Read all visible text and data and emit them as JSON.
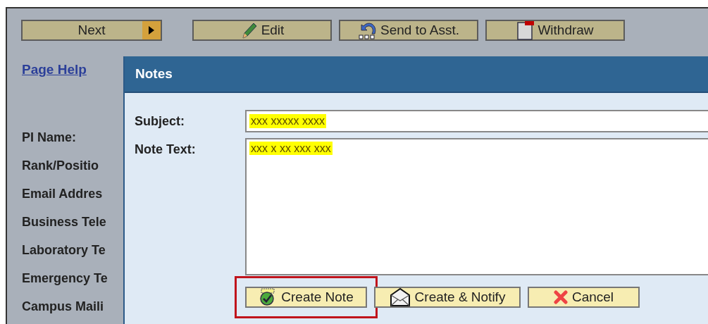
{
  "toolbar": [
    {
      "label": "Next",
      "kind": "next"
    },
    {
      "label": "Edit",
      "kind": "edit"
    },
    {
      "label": "Send to Asst.",
      "kind": "send"
    },
    {
      "label": "Withdraw",
      "kind": "withdraw"
    }
  ],
  "page_help": "Page Help",
  "form_labels": [
    "PI Name:",
    "Rank/Positio",
    "Email Addres",
    "Business Tele",
    "Laboratory Te",
    "Emergency Te",
    "Campus Maili"
  ],
  "dialog": {
    "title": "Notes",
    "subject": {
      "label": "Subject:",
      "value": "xxx xxxxx xxxx",
      "highlighted": true
    },
    "note_text": {
      "label": "Note Text:",
      "value": "xxx x xx xxx xxx",
      "highlighted": true
    },
    "buttons": [
      {
        "label": "Create Note",
        "kind": "create",
        "highlighted": true
      },
      {
        "label": "Create & Notify",
        "kind": "notify",
        "highlighted": false
      },
      {
        "label": "Cancel",
        "kind": "cancel",
        "highlighted": false
      }
    ]
  }
}
